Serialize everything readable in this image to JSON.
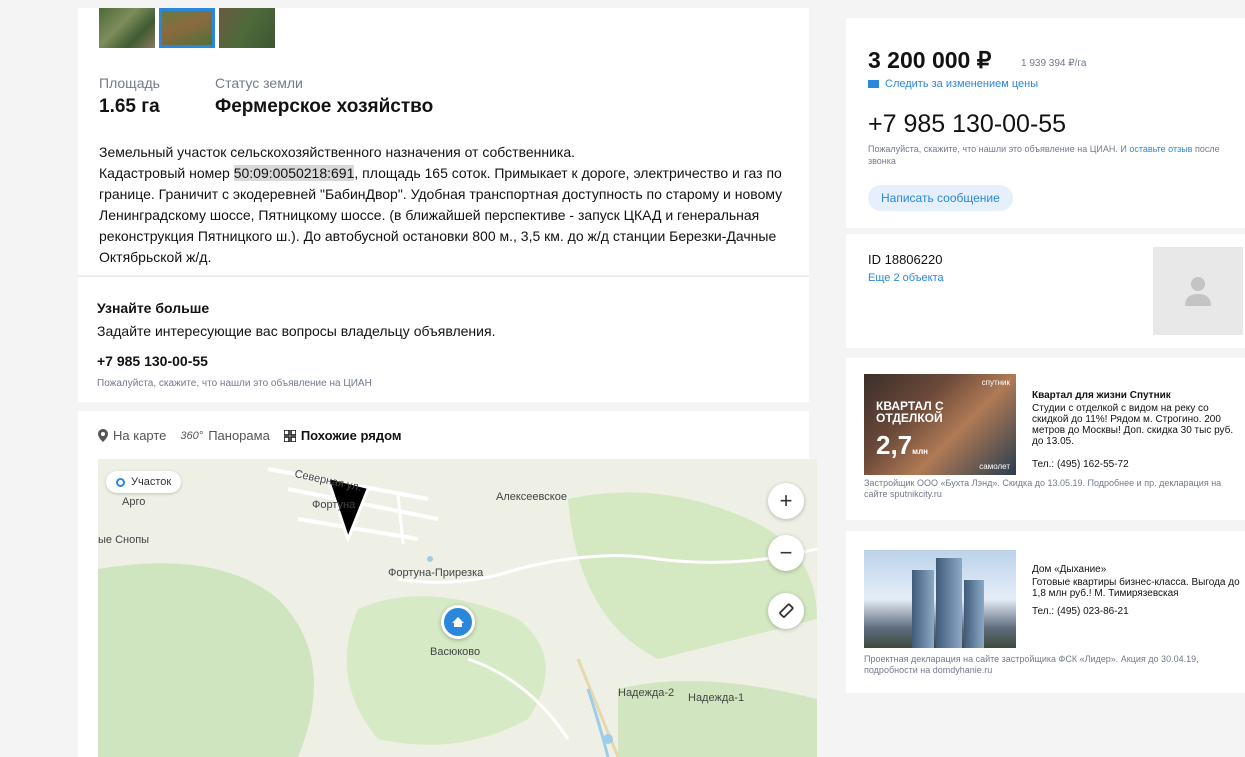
{
  "listing": {
    "area_label": "Площадь",
    "area_value": "1.65 га",
    "status_label": "Статус земли",
    "status_value": "Фермерское хозяйство",
    "description_line1": "Земельный участок сельскохозяйственного назначения от собственника.",
    "description_pre": "Кадастровый номер ",
    "cadastral_number": "50:09:0050218:691",
    "description_post": ", площадь 165 соток. Примыкает к дороге, электричество и газ по границе. Граничит с экодеревней \"БабинДвор\". Удобная транспортная доступность по старому и новому Ленинградскому шоссе, Пятницкому шоссе. (в ближайшей перспективе - запуск ЦКАД и генеральная реконструкция Пятницкого ш.). До автобусной остановки 800 м., 3,5 км. до ж/д станции Березки-Дачные Октябрьской ж/д."
  },
  "learn_more": {
    "title": "Узнайте больше",
    "subtitle": "Задайте интересующие вас вопросы владельцу объявления.",
    "phone": "+7 985 130-00-55",
    "note": "Пожалуйста, скажите, что нашли это объявление на ЦИАН"
  },
  "map": {
    "tabs": [
      {
        "label": "На карте",
        "icon": "pin-icon"
      },
      {
        "label": "Панорама",
        "icon": "panorama-360-icon"
      },
      {
        "label": "Похожие рядом",
        "icon": "grid-icon"
      }
    ],
    "legend": "Участок",
    "labels": {
      "severnaya": "Северная ул.",
      "fortuna": "Фортуна",
      "argo": "Арго",
      "alekseevskoe": "Алексеевское",
      "snopy": "ые Снопы",
      "fortuna_prirezka": "Фортуна-Прирезка",
      "vasyukovo": "Васюково",
      "nadezhda2": "Надежда-2",
      "nadezhda1": "Надежда-1"
    }
  },
  "price": {
    "value": "3 200 000 ₽",
    "per_area": "1 939 394 ₽/га",
    "watch_label": "Следить за изменением цены",
    "phone": "+7 985 130-00-55",
    "note_pre": "Пожалуйста, скажите, что нашли это объявление на ЦИАН. И ",
    "note_link": "оставьте отзыв",
    "note_post": " после звонка",
    "message_button": "Написать сообщение"
  },
  "owner": {
    "id": "ID 18806220",
    "more_objects": "Еще 2 объекта"
  },
  "ads": [
    {
      "title": "Квартал для жизни Спутник",
      "text": "Студии с отделкой с видом на реку со скидкой до 11%! Рядом м. Строгино. 200 метров до Москвы! Доп. скидка 30 тыс руб. до 13.05.",
      "phone": "Тел.: (495) 162-55-72",
      "footer": "Застройщик ООО «Бухта Лэнд». Скидка до 13.05.19. Подробнее и пр. декларация на сайте sputnikcity.ru",
      "image_brand": "спутник",
      "image_headline": "КВАРТАЛ С ОТДЕЛКОЙ",
      "image_price": "2,7",
      "image_unit": "млн",
      "image_developer": "самолет"
    },
    {
      "title": "Дом «Дыхание»",
      "text": "Готовые квартиры бизнес-класса. Выгода до 1,8 млн руб.! М. Тимирязевская",
      "phone": "Тел.: (495) 023-86-21",
      "footer": "Проектная декларация на сайте застройщика ФСК «Лидер». Акция до 30.04.19, подробности на domdyhanie.ru"
    }
  ]
}
